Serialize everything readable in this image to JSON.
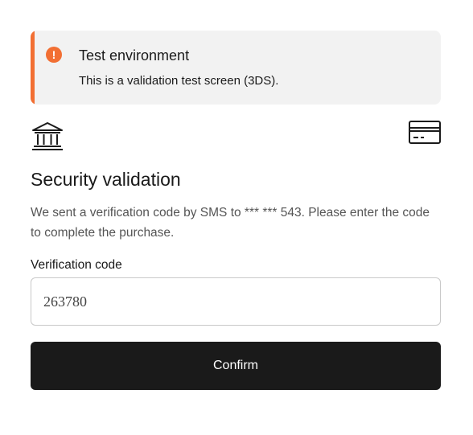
{
  "alert": {
    "title": "Test environment",
    "message": "This is a validation test screen (3DS).",
    "icon": "!",
    "accent_color": "#f26f33"
  },
  "icons": {
    "left": "bank-icon",
    "right": "credit-card-icon"
  },
  "validation": {
    "heading": "Security validation",
    "description": "We sent a verification code by SMS to *** *** 543. Please enter the code to complete the purchase.",
    "field_label": "Verification code",
    "code_value": "263780",
    "confirm_label": "Confirm"
  },
  "colors": {
    "button_bg": "#1a1a1a",
    "alert_bg": "#f2f2f2"
  }
}
